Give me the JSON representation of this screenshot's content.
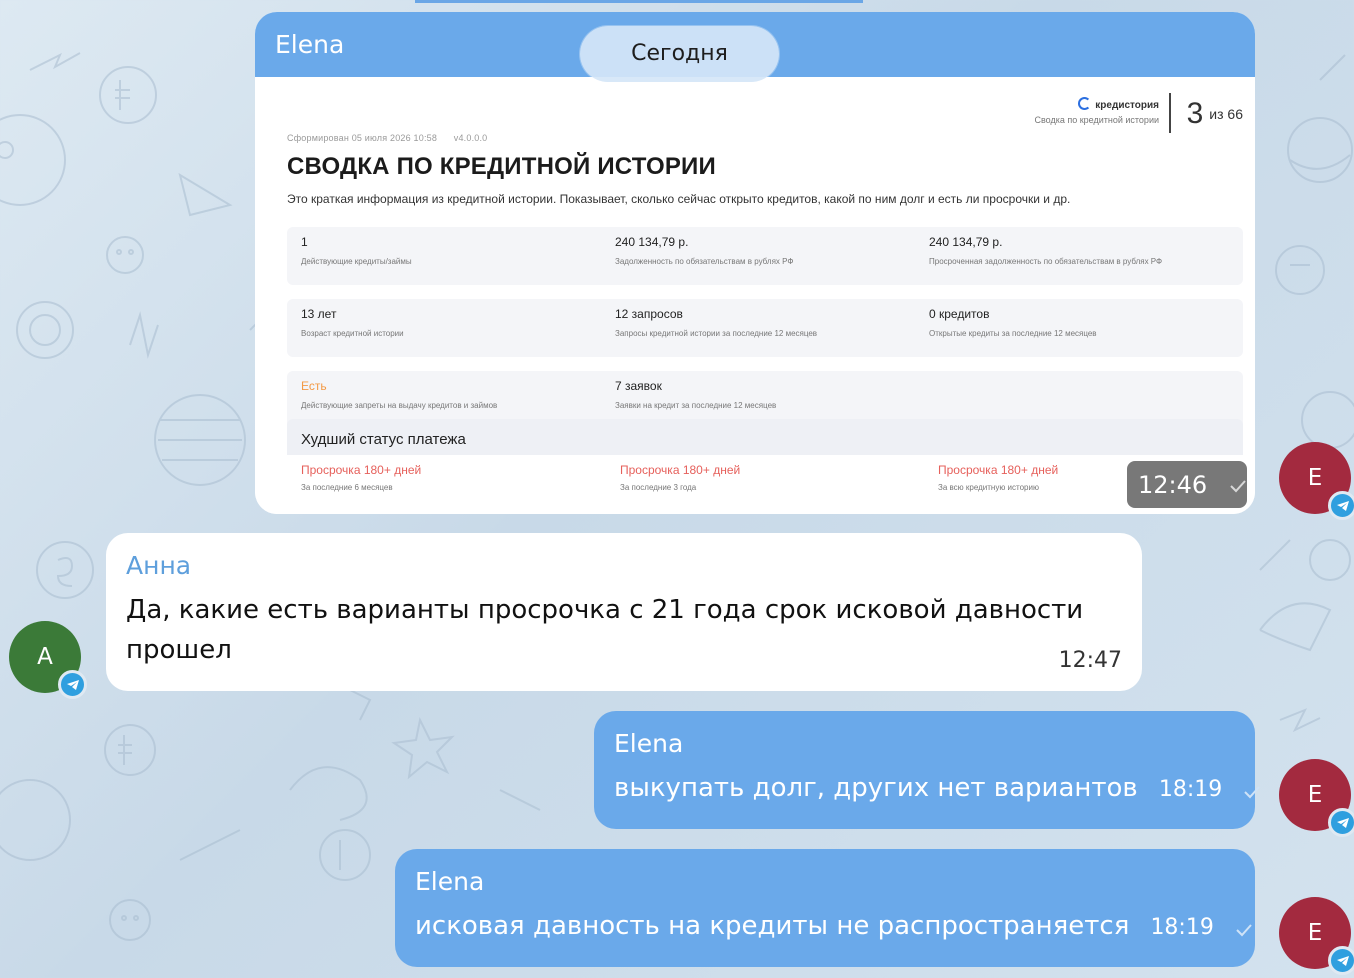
{
  "date_pill": "Сегодня",
  "image_message": {
    "sender": "Elena",
    "time": "12:46",
    "document": {
      "meta_generated": "Сформирован 05 июля 2026 10:58",
      "meta_version": "v4.0.0.0",
      "brand": "кредистория",
      "brand_sub": "Сводка по кредитной истории",
      "page_current": "3",
      "page_total": "из 66",
      "title": "СВОДКА ПО КРЕДИТНОЙ ИСТОРИИ",
      "description": "Это краткая информация из кредитной истории. Показывает, сколько сейчас открыто кредитов, какой по ним долг и есть ли просрочки и др.",
      "stats": [
        [
          {
            "value": "1",
            "label": "Действующие кредиты/займы"
          },
          {
            "value": "240 134,79 р.",
            "label": "Задолженность по обязательствам в рублях РФ"
          },
          {
            "value": "240 134,79 р.",
            "label": "Просроченная задолженность по обязательствам в рублях РФ"
          }
        ],
        [
          {
            "value": "13 лет",
            "label": "Возраст кредитной истории"
          },
          {
            "value": "12 запросов",
            "label": "Запросы кредитной истории за последние 12 месяцев"
          },
          {
            "value": "0 кредитов",
            "label": "Открытые кредиты за последние 12 месяцев"
          }
        ],
        [
          {
            "value": "Есть",
            "label": "Действующие запреты на выдачу кредитов и займов"
          },
          {
            "value": "7 заявок",
            "label": "Заявки на кредит за последние 12 месяцев"
          }
        ]
      ],
      "worst_status_title": "Худший статус платежа",
      "worst_status": [
        {
          "value": "Просрочка 180+ дней",
          "label": "За последние 6 месяцев"
        },
        {
          "value": "Просрочка 180+ дней",
          "label": "За последние 3 года"
        },
        {
          "value": "Просрочка 180+ дней",
          "label": "За всю кредитную историю"
        }
      ]
    }
  },
  "messages": [
    {
      "sender": "Анна",
      "text_line1": "Да, какие есть варианты просрочка с 21 года срок исковой давности",
      "text_line2": "прошел",
      "time": "12:47",
      "avatar": "А"
    },
    {
      "sender": "Elena",
      "text": "выкупать долг, других нет вариантов",
      "time": "18:19",
      "avatar": "E"
    },
    {
      "sender": "Elena",
      "text": "исковая давность на кредиты не распространяется",
      "time": "18:19",
      "avatar": "E"
    }
  ],
  "image_avatar": "E",
  "colors": {
    "outgoing_bubble": "#6aa9ea",
    "incoming_bubble": "#ffffff",
    "sender_incoming": "#5e9fdc",
    "avatar_elena": "#a32a3f",
    "avatar_anna": "#3b7a38",
    "telegram_badge": "#2f9fdf",
    "overdue_red": "#e6605b",
    "warning_orange": "#f39a45"
  }
}
